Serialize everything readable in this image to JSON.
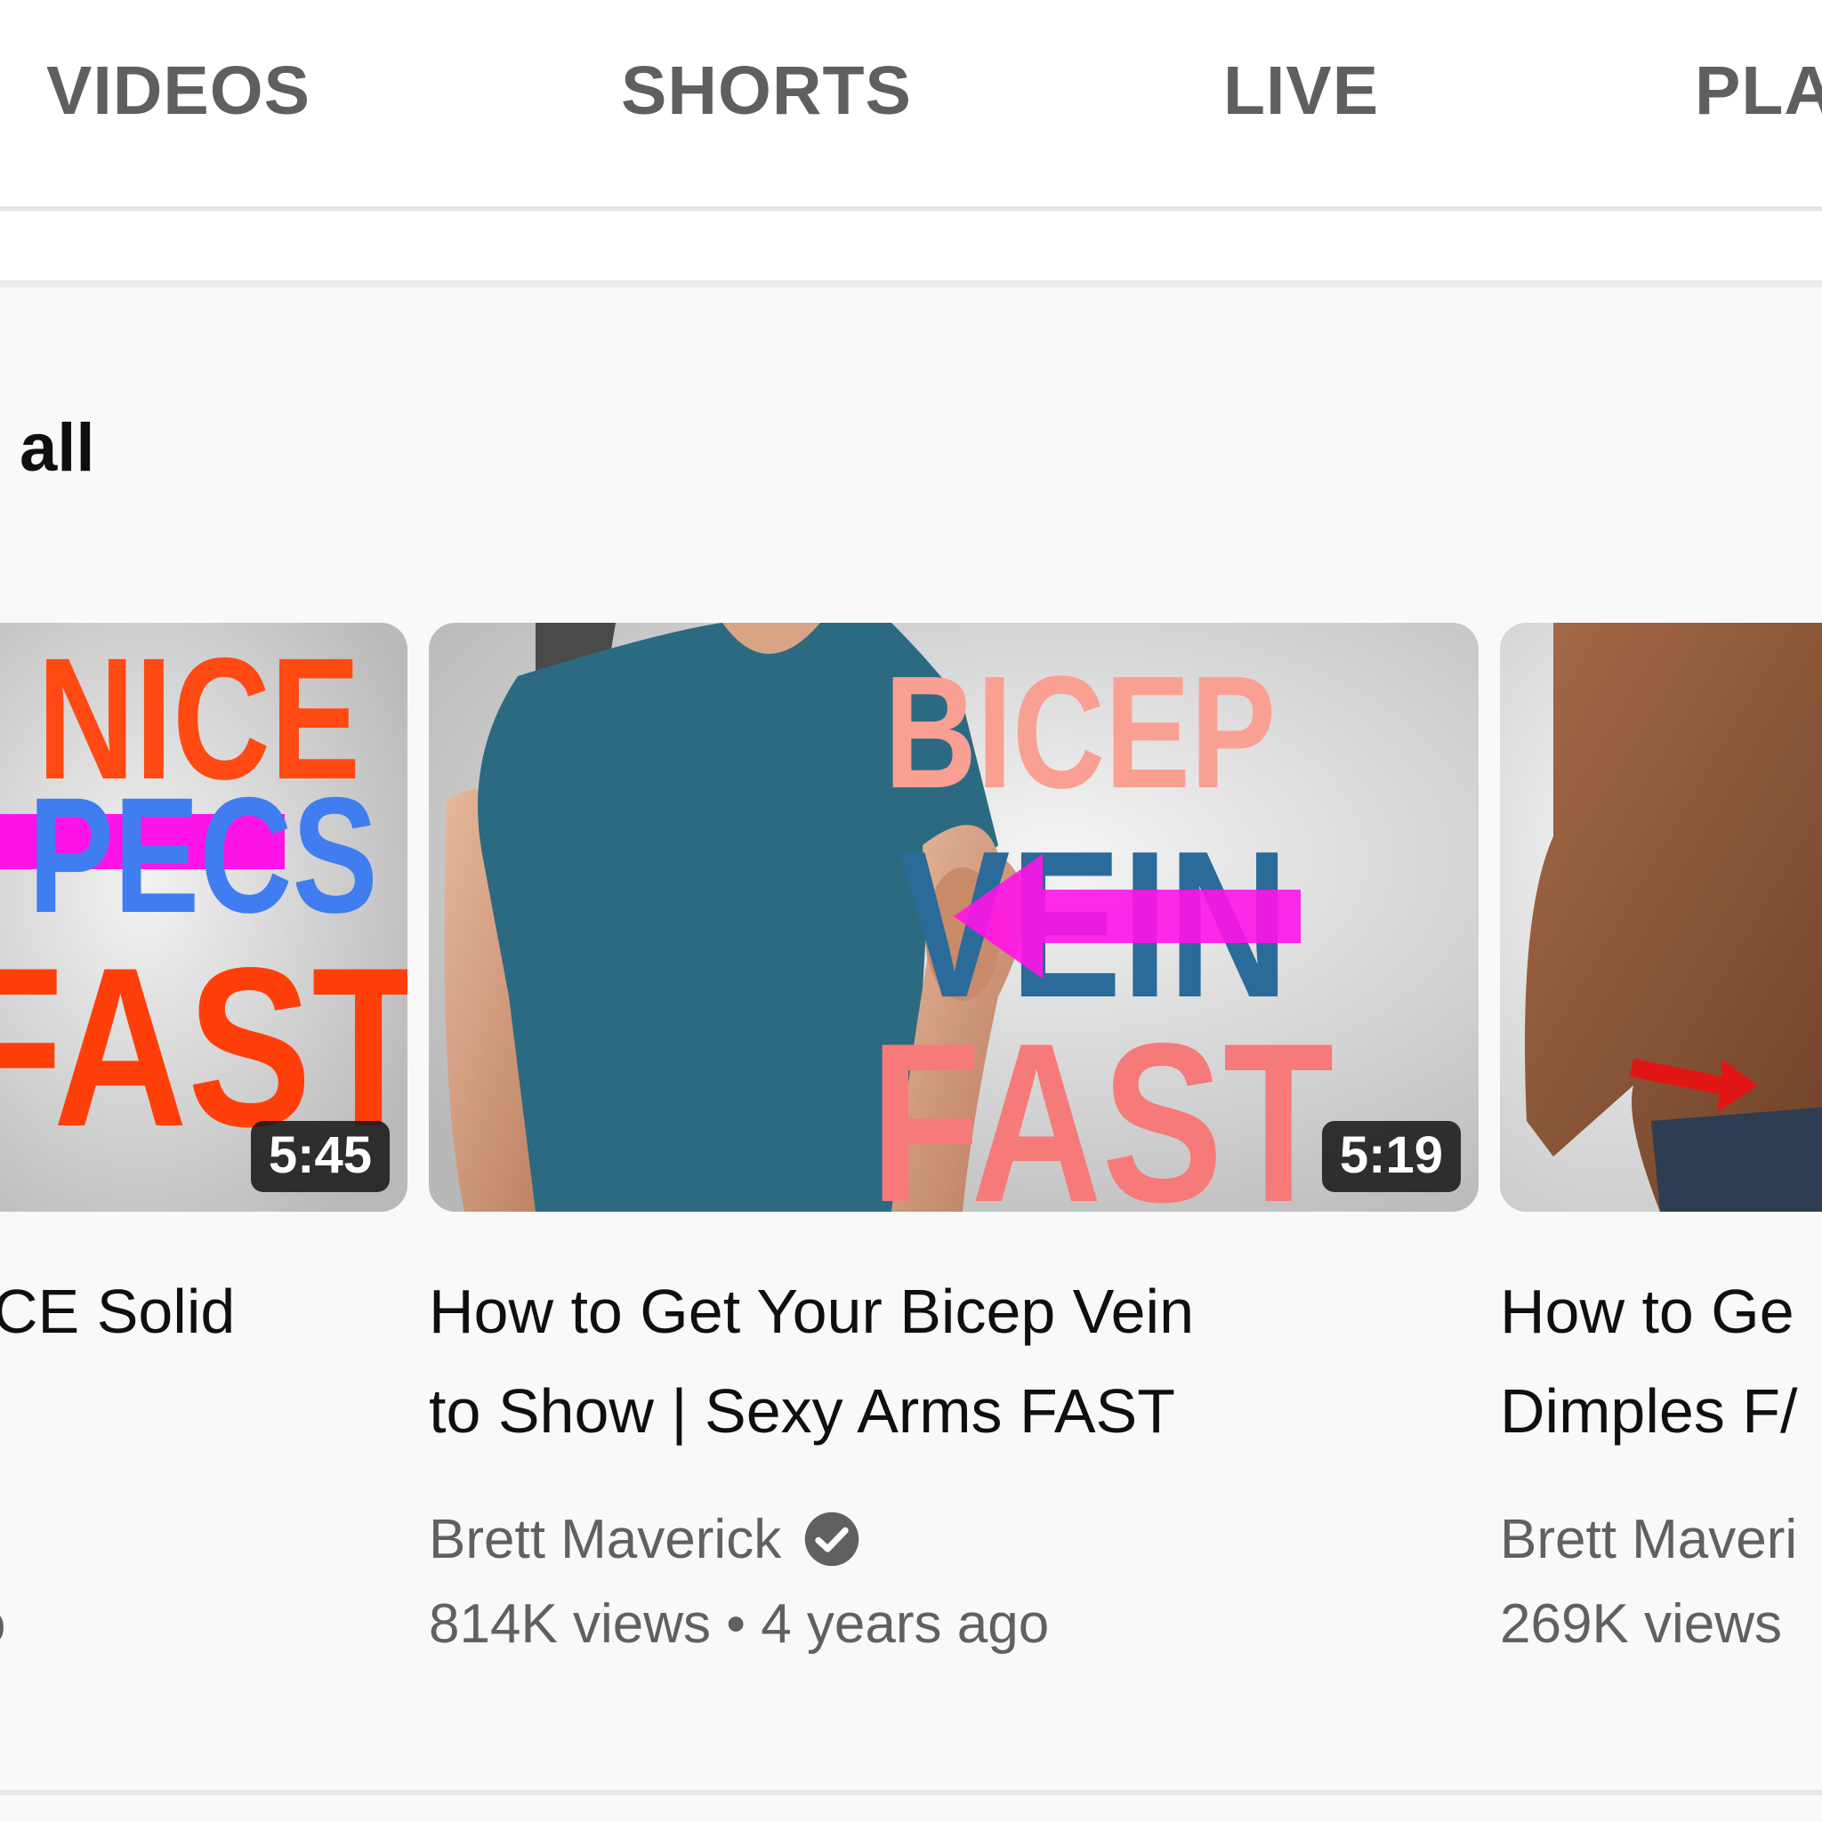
{
  "tabs": [
    {
      "label": "VIDEOS"
    },
    {
      "label": "SHORTS"
    },
    {
      "label": "LIVE"
    },
    {
      "label": "PLA"
    }
  ],
  "section": {
    "play_all_label": "all"
  },
  "videos": [
    {
      "thumb_text": [
        "NICE",
        "PECS",
        "FAST"
      ],
      "duration": "5:45",
      "title_lines": [
        "CE Solid"
      ],
      "channel": "",
      "meta": "o"
    },
    {
      "thumb_text": [
        "BICEP",
        "VEIN",
        "FAST"
      ],
      "duration": "5:19",
      "title_lines": [
        "How to Get Your Bicep Vein",
        "to Show | Sexy Arms FAST"
      ],
      "channel": "Brett Maverick",
      "meta": "814K views • 4 years ago"
    },
    {
      "thumb_text": [],
      "duration": "",
      "title_lines": [
        "How to Ge",
        "Dimples F/"
      ],
      "channel": "Brett Maveri",
      "meta": "269K views"
    }
  ],
  "colors": {
    "nice": "#ff4a14",
    "pecs": "#3f7df0",
    "fast_orange": "#ff3f0a",
    "bicep": "#f9a092",
    "vein": "#2b6b99",
    "fast_pink": "#f77a7a",
    "arrow": "#ff14e8",
    "shirt": "#2c6a82"
  }
}
